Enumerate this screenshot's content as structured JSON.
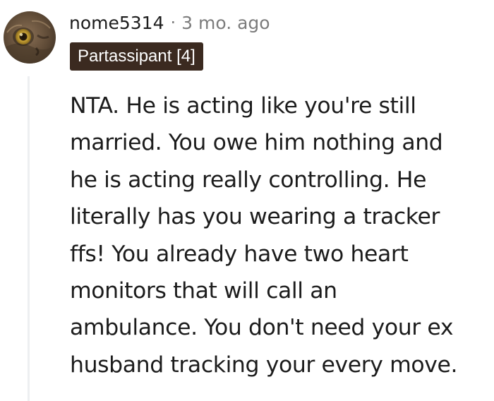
{
  "comment": {
    "author": "nome5314",
    "separator": "·",
    "timestamp": "3 mo. ago",
    "flair": "Partassipant [4]",
    "body_lines": [
      "NTA. He is acting like you're still",
      "married. You owe him nothing and",
      "he is acting really controlling. He",
      "literally has you wearing a tracker",
      "ffs! You already have two heart",
      "monitors that will call an",
      "ambulance. You don't need your ex",
      "husband tracking your every move."
    ]
  },
  "avatar": {
    "icon": "owl-avatar-icon"
  },
  "colors": {
    "flair_background": "#3b2a20",
    "flair_text": "#ffffff",
    "meta_text": "#7c7c7c",
    "body_text": "#1c1c1c",
    "thread_line": "#edeff1"
  }
}
